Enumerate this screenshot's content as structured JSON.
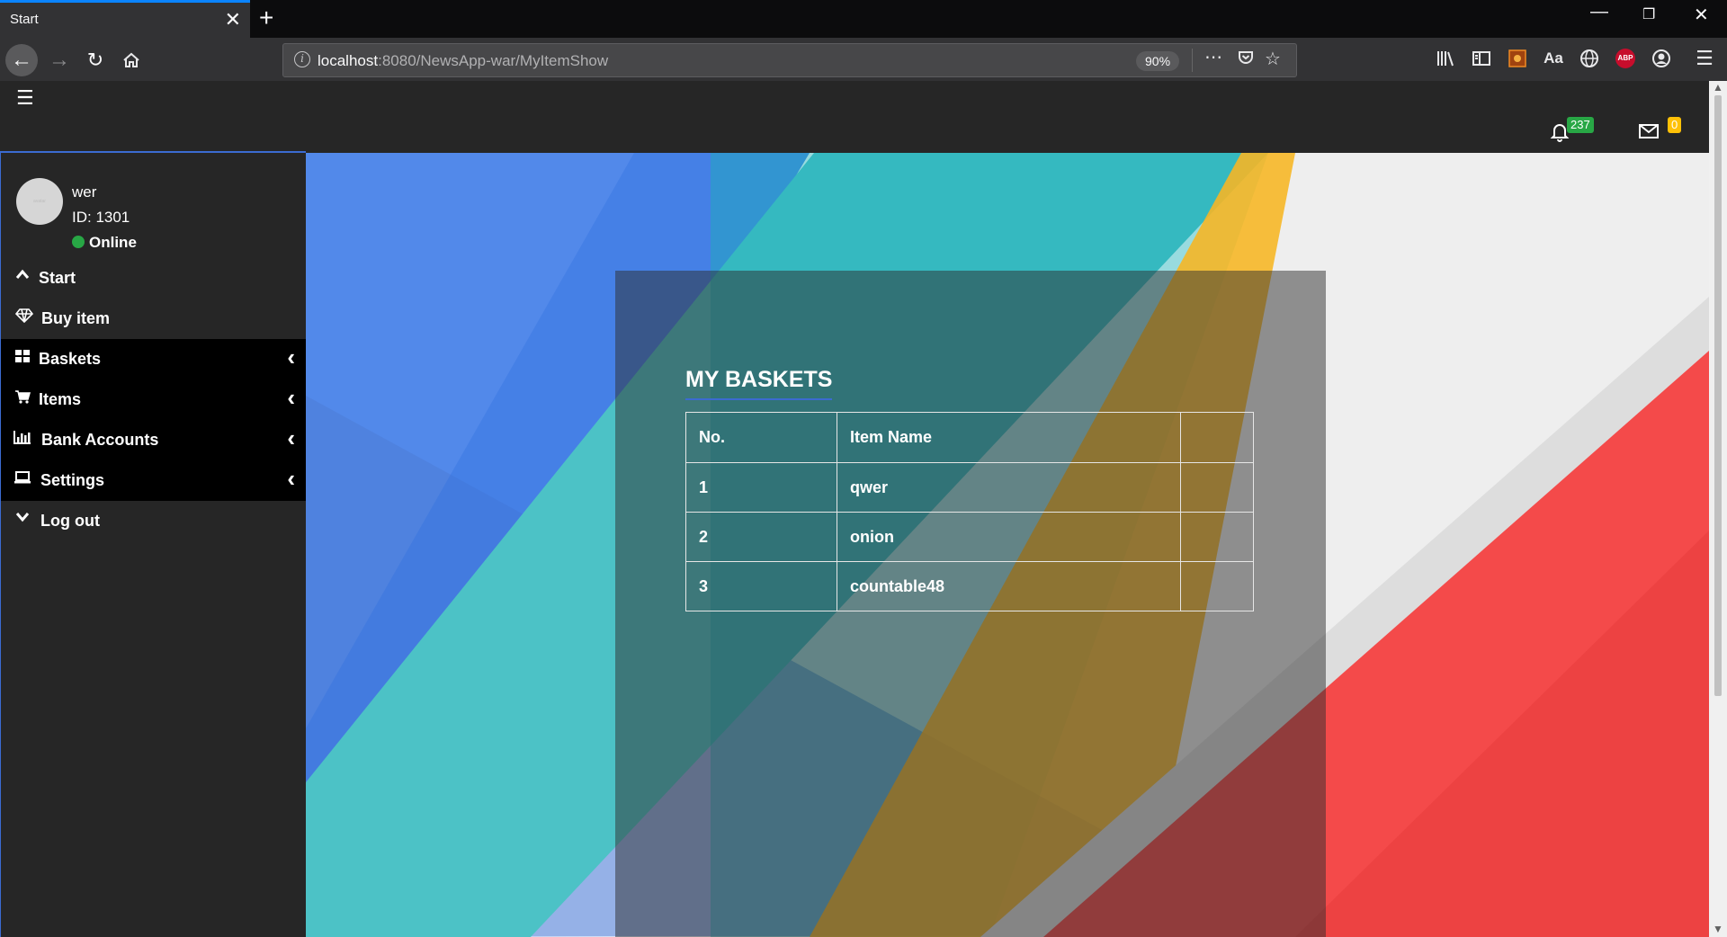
{
  "browser": {
    "tab_title": "Start",
    "tab_close": "✕",
    "new_tab": "+",
    "url_host": "localhost",
    "url_path": ":8080/NewsApp-war/MyItemShow",
    "zoom": "90%",
    "icons": [
      "back-icon",
      "forward-icon",
      "reload-icon",
      "home-icon",
      "info-icon",
      "more-icon",
      "pocket-icon",
      "bookmark-star-icon",
      "library-icon",
      "sidebar-icon",
      "extension-icon",
      "reader-icon",
      "globe-icon",
      "adblock-icon",
      "account-icon",
      "menu-icon"
    ],
    "abp_label": "ABP",
    "aa_label": "Aa"
  },
  "topbar": {
    "notifications_count": "237",
    "messages_count": "0",
    "badge_colors": {
      "notifications": "#28a745",
      "messages": "#ffc107"
    }
  },
  "user": {
    "name": "wer",
    "id": "ID: 1301",
    "status": "Online",
    "status_color": "#28a745"
  },
  "sidebar": {
    "items": [
      {
        "label": "Start",
        "icon": "chevron-up-icon",
        "expandable": false
      },
      {
        "label": "Buy item",
        "icon": "diamond-icon",
        "expandable": false
      },
      {
        "label": "Baskets",
        "icon": "grid-icon",
        "expandable": true
      },
      {
        "label": "Items",
        "icon": "cart-icon",
        "expandable": true
      },
      {
        "label": "Bank Accounts",
        "icon": "bar-chart-icon",
        "expandable": true
      },
      {
        "label": "Settings",
        "icon": "laptop-icon",
        "expandable": true
      },
      {
        "label": "Log out",
        "icon": "chevron-down-icon",
        "expandable": false
      }
    ]
  },
  "main": {
    "title": "MY BASKETS",
    "table": {
      "headers": [
        "No.",
        "Item Name",
        ""
      ],
      "rows": [
        [
          "1",
          "qwer",
          ""
        ],
        [
          "2",
          "onion",
          ""
        ],
        [
          "3",
          "countable48",
          ""
        ]
      ]
    }
  }
}
